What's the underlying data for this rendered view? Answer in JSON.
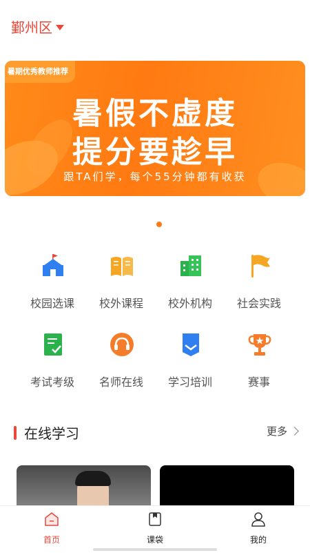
{
  "header": {
    "district": "鄞州区"
  },
  "banner": {
    "tag": "暑期优秀教师推荐",
    "line1": "暑假不虚度",
    "line2": "提分要趁早",
    "subtitle": "跟TA们学，每个55分钟都有收获"
  },
  "carousel": {
    "count": 1,
    "active": 0
  },
  "categories": [
    {
      "label": "校园选课",
      "icon": "school-icon",
      "color": "#2f7ff0"
    },
    {
      "label": "校外课程",
      "icon": "book-icon",
      "color": "#f5a623"
    },
    {
      "label": "校外机构",
      "icon": "building-icon",
      "color": "#2bb24c"
    },
    {
      "label": "社会实践",
      "icon": "flag-icon",
      "color": "#f5a623"
    },
    {
      "label": "考试考级",
      "icon": "checklist-icon",
      "color": "#2bb24c"
    },
    {
      "label": "名师在线",
      "icon": "headset-icon",
      "color": "#f57c2a"
    },
    {
      "label": "学习培训",
      "icon": "bookmark-icon",
      "color": "#2f7ff0"
    },
    {
      "label": "赛事",
      "icon": "trophy-icon",
      "color": "#f57c2a"
    }
  ],
  "section": {
    "title": "在线学习",
    "more": "更多"
  },
  "tabs": [
    {
      "label": "首页",
      "icon": "home-icon",
      "active": true
    },
    {
      "label": "课袋",
      "icon": "bag-icon",
      "active": false
    },
    {
      "label": "我的",
      "icon": "profile-icon",
      "active": false
    }
  ],
  "colors": {
    "accent": "#e8473a",
    "banner": "#ff7a12"
  }
}
